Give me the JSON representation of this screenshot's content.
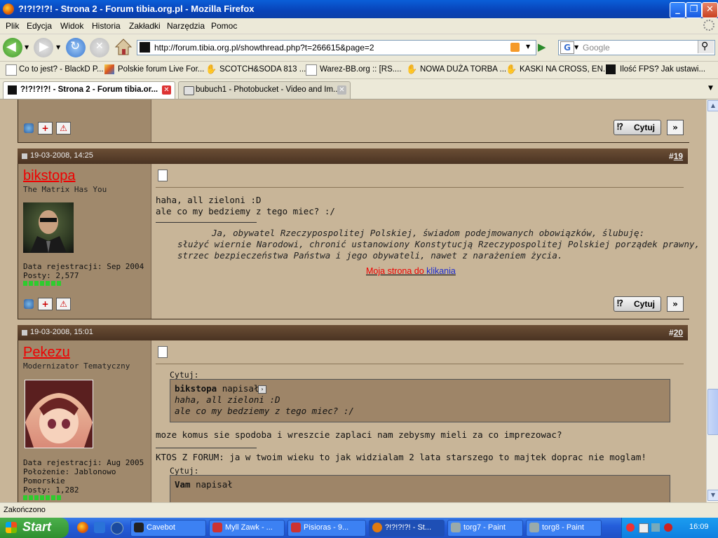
{
  "window": {
    "title": "?!?!?!?! - Strona 2 - Forum tibia.org.pl - Mozilla Firefox"
  },
  "menubar": [
    "Plik",
    "Edycja",
    "Widok",
    "Historia",
    "Zakładki",
    "Narzędzia",
    "Pomoc"
  ],
  "navbar": {
    "url": "http://forum.tibia.org.pl/showthread.php?t=266615&page=2",
    "search_placeholder": "Google"
  },
  "bookmarks": [
    "Co to jest? - BlackD P...",
    "Polskie forum Live For...",
    "SCOTCH&SODA 813 ...",
    "Warez-BB.org :: [RS....",
    "NOWA DUŻA TORBA ...",
    "KASKI NA CROSS, EN...",
    "Ilość FPS? Jak ustawi..."
  ],
  "tabs": [
    {
      "label": "?!?!?!?! - Strona 2 - Forum tibia.or...",
      "active": true
    },
    {
      "label": "bubuch1 - Photobucket - Video and Im...",
      "active": false
    }
  ],
  "buttons": {
    "quote": "Cytuj"
  },
  "posts": [
    {
      "date": "19-03-2008, 14:25",
      "hash": "#",
      "number": "19",
      "username": "bikstopa",
      "user_title": "The Matrix Has You",
      "reg": "Data rejestracji: Sep 2004",
      "posts": "Posty: 2,577",
      "lines": [
        "haha, all zieloni :D",
        "ale co my bedziemy z tego miec? :/"
      ],
      "sig": [
        "Ja, obywatel Rzeczypospolitej Polskiej, świadom podejmowanych obowiązków, ślubuję:",
        "służyć wiernie Narodowi, chronić ustanowiony Konstytucją Rzeczypospolitej Polskiej porządek prawny,",
        "strzec bezpieczeństwa Państwa i jego obywateli, nawet z narażeniem życia."
      ],
      "sig_link_a": "Moja strona do ",
      "sig_link_b": "klikania"
    },
    {
      "date": "19-03-2008, 15:01",
      "hash": "#",
      "number": "20",
      "username": "Pekezu",
      "user_title": "Modernizator Tematyczny",
      "reg": "Data rejestracji: Aug 2005",
      "location_1": "Położenie: Jablonowo",
      "location_2": "Pomorskie",
      "posts": "Posty: 1,282",
      "quote_label": "Cytuj:",
      "quote_author": "bikstopa",
      "quote_said": "napisał",
      "quote_lines": [
        "haha, all zieloni :D",
        "ale co my bedziemy z tego miec? :/"
      ],
      "line_after_quote": "moze komus sie spodoba i wreszcie zaplaci nam zebysmy mieli za co imprezowac?",
      "sig_line": "KTOS Z FORUM: ja w twoim wieku to jak widzialam 2 lata starszego to majtek doprac nie moglam!",
      "quote2_label": "Cytuj:",
      "quote2_author": "Vam",
      "quote2_said": "napisał"
    }
  ],
  "status": "Zakończono",
  "taskbar": {
    "start": "Start",
    "tasks": [
      "Cavebot",
      "Myll Zawk - ...",
      "Pisioras - 9...",
      "?!?!?!?! - St...",
      "torg7 - Paint",
      "torg8 - Paint"
    ],
    "clock": "16:09"
  }
}
